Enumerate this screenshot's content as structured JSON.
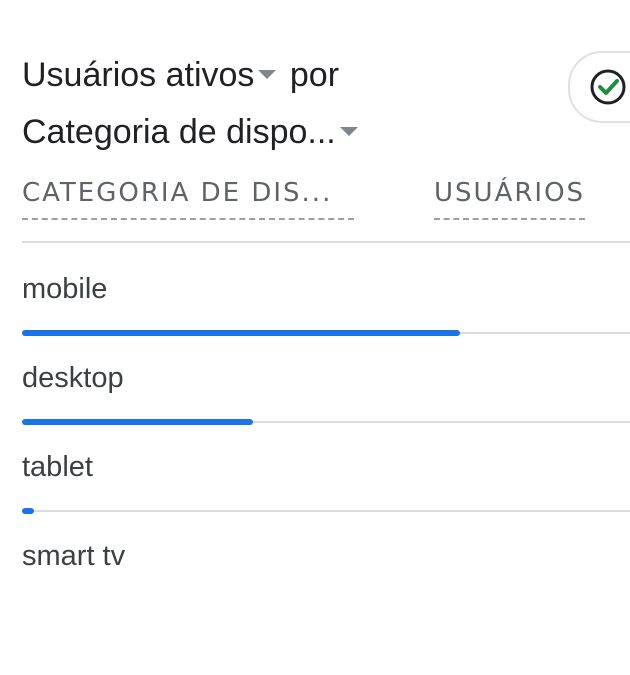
{
  "card": {
    "title_metric": "Usuários ativos",
    "title_connector": "por",
    "title_dimension": "Categoria de dispo...",
    "check_icon": "check-circle-icon"
  },
  "table": {
    "headers": [
      "CATEGORIA DE DIS...",
      "USUÁRIOS"
    ],
    "rows": [
      {
        "label": "mobile",
        "share": 0.72
      },
      {
        "label": "desktop",
        "share": 0.38
      },
      {
        "label": "tablet",
        "share": 0.02
      },
      {
        "label": "smart tv",
        "share": 0
      }
    ]
  },
  "colors": {
    "bar": "#1a73e8",
    "check": "#1e8e3e",
    "text": "#202124"
  }
}
